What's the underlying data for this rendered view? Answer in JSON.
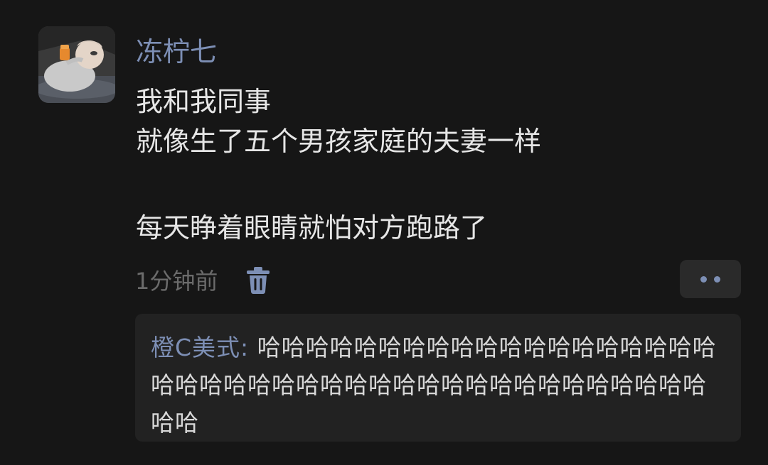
{
  "post": {
    "author": "冻柠七",
    "lines": [
      "我和我同事",
      "就像生了五个男孩家庭的夫妻一样",
      "每天睁着眼睛就怕对方跑路了"
    ],
    "timestamp": "1分钟前"
  },
  "icons": {
    "delete": "trash-icon",
    "more": "more-dots-icon"
  },
  "reply": {
    "author": "橙C美式",
    "separator": ": ",
    "text": "哈哈哈哈哈哈哈哈哈哈哈哈哈哈哈哈哈哈哈哈哈哈哈哈哈哈哈哈哈哈哈哈哈哈哈哈哈哈哈哈哈哈哈哈"
  },
  "colors": {
    "background": "#161616",
    "username": "#7d8fb5",
    "text": "#e6e6e6",
    "muted": "#6b6b6b",
    "reply_box": "#222222"
  }
}
